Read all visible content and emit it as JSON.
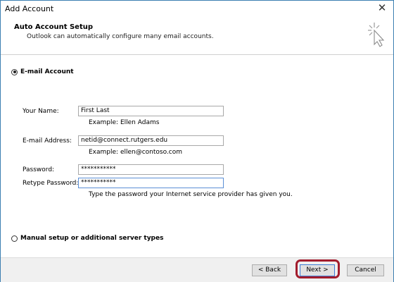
{
  "window": {
    "title": "Add Account"
  },
  "header": {
    "title": "Auto Account Setup",
    "subtitle": "Outlook can automatically configure many email accounts."
  },
  "options": {
    "email_account": {
      "label": "E-mail Account",
      "selected": true
    },
    "manual_setup": {
      "label": "Manual setup or additional server types",
      "selected": false
    }
  },
  "form": {
    "name": {
      "label": "Your Name:",
      "value": "First Last",
      "example": "Example: Ellen Adams"
    },
    "email": {
      "label": "E-mail Address:",
      "value": "netid@connect.rutgers.edu",
      "example": "Example: ellen@contoso.com"
    },
    "password": {
      "label": "Password:",
      "value": "***********"
    },
    "retype": {
      "label": "Retype Password:",
      "value": "***********",
      "hint": "Type the password your Internet service provider has given you."
    }
  },
  "buttons": {
    "back": "< Back",
    "next": "Next >",
    "cancel": "Cancel"
  },
  "colors": {
    "highlight": "#a21c2d",
    "window_border": "#3c7fb1"
  }
}
